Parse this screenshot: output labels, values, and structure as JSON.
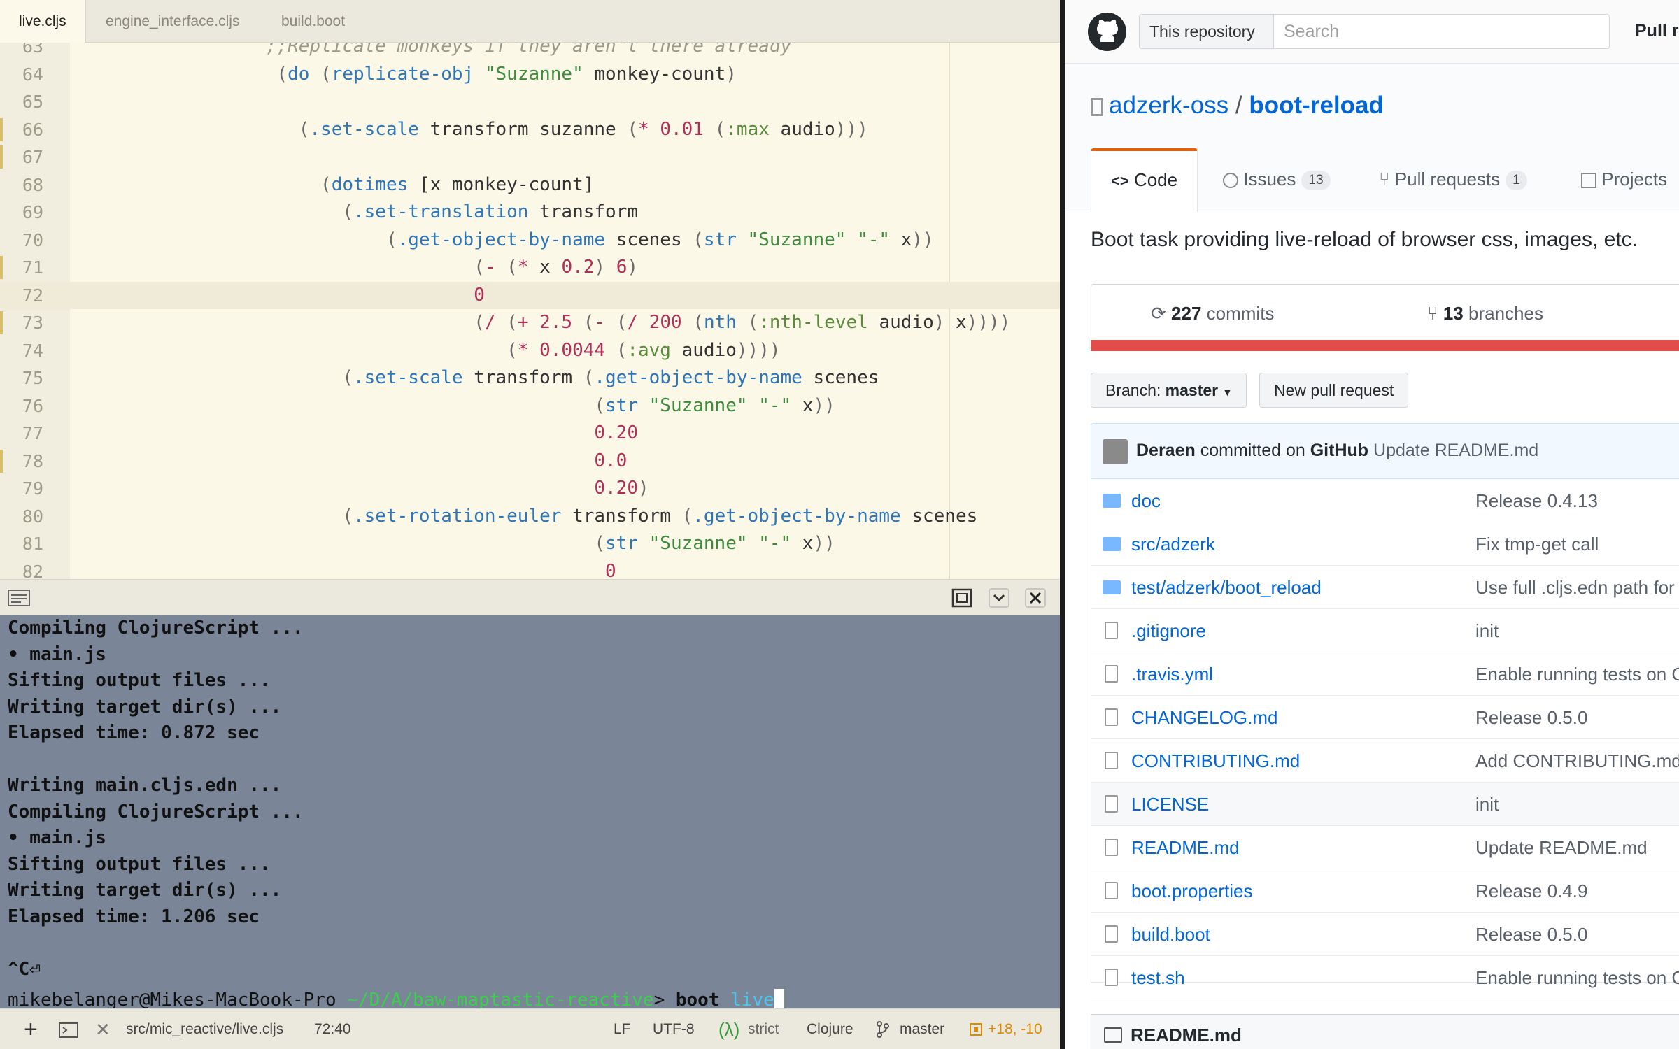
{
  "editor": {
    "tabs": [
      {
        "label": "live.cljs"
      },
      {
        "label": "engine_interface.cljs"
      },
      {
        "label": "build.boot"
      }
    ],
    "lines": [
      {
        "n": "63",
        "html": "<span class=\"cmt\">                  ;;Replicate monkeys if they aren't there already</span>",
        "mark": false
      },
      {
        "n": "64",
        "html": "                   <span class=\"br\">(</span><span class=\"fn\">do</span> <span class=\"br\">(</span><span class=\"fn\">replicate-obj</span> <span class=\"str\">\"Suzanne\"</span> monkey-count<span class=\"br\">)</span>",
        "mark": false
      },
      {
        "n": "65",
        "html": "",
        "mark": false
      },
      {
        "n": "66",
        "html": "                     <span class=\"br\">(</span><span class=\"fn\">.set-scale</span> transform suzanne <span class=\"br\">(</span><span class=\"op\">*</span> <span class=\"num\">0.01</span> <span class=\"br\">(</span><span class=\"kw\">:max</span> audio<span class=\"br\">)))</span>",
        "mark": true
      },
      {
        "n": "67",
        "html": "",
        "mark": true
      },
      {
        "n": "68",
        "html": "                       <span class=\"br\">(</span><span class=\"fn\">dotimes</span> [x monkey-count]",
        "mark": false
      },
      {
        "n": "69",
        "html": "                         <span class=\"br\">(</span><span class=\"fn\">.set-translation</span> transform",
        "mark": false
      },
      {
        "n": "70",
        "html": "                             <span class=\"br\">(</span><span class=\"fn\">.get-object-by-name</span> scenes <span class=\"br\">(</span><span class=\"fn\">str</span> <span class=\"str\">\"Suzanne\"</span> <span class=\"str\">\"-\"</span> x<span class=\"br\">))</span>",
        "mark": false
      },
      {
        "n": "71",
        "html": "                                     <span class=\"br\">(</span><span class=\"op\">-</span> <span class=\"br\">(</span><span class=\"op\">*</span> x <span class=\"num\">0.2</span><span class=\"br\">)</span> <span class=\"num\">6</span><span class=\"br\">)</span>",
        "mark": true
      },
      {
        "n": "72",
        "html": "                                     <span class=\"num\">0</span>",
        "mark": false,
        "cur": true
      },
      {
        "n": "73",
        "html": "                                     <span class=\"br\">(</span><span class=\"op\">/</span> <span class=\"br\">(</span><span class=\"op\">+</span> <span class=\"num\">2.5</span> <span class=\"br\">(</span><span class=\"op\">-</span> <span class=\"br\">(</span><span class=\"op\">/</span> <span class=\"num\">200</span> <span class=\"br\">(</span><span class=\"fn\">nth</span> <span class=\"br\">(</span><span class=\"kw\">:nth-level</span> audio<span class=\"br\">)</span> x<span class=\"br\">))))</span>",
        "mark": true
      },
      {
        "n": "74",
        "html": "                                        <span class=\"br\">(</span><span class=\"op\">*</span> <span class=\"num\">0.0044</span> <span class=\"br\">(</span><span class=\"kw\">:avg</span> audio<span class=\"br\">))))</span>",
        "mark": false
      },
      {
        "n": "75",
        "html": "                         <span class=\"br\">(</span><span class=\"fn\">.set-scale</span> transform <span class=\"br\">(</span><span class=\"fn\">.get-object-by-name</span> scenes",
        "mark": false
      },
      {
        "n": "76",
        "html": "                                                <span class=\"br\">(</span><span class=\"fn\">str</span> <span class=\"str\">\"Suzanne\"</span> <span class=\"str\">\"-\"</span> x<span class=\"br\">))</span>",
        "mark": false
      },
      {
        "n": "77",
        "html": "                                                <span class=\"num\">0.20</span>",
        "mark": false
      },
      {
        "n": "78",
        "html": "                                                <span class=\"num\">0.0</span>",
        "mark": true
      },
      {
        "n": "79",
        "html": "                                                <span class=\"num\">0.20</span><span class=\"br\">)</span>",
        "mark": false
      },
      {
        "n": "80",
        "html": "                         <span class=\"br\">(</span><span class=\"fn\">.set-rotation-euler</span> transform <span class=\"br\">(</span><span class=\"fn\">.get-object-by-name</span> scenes",
        "mark": false
      },
      {
        "n": "81",
        "html": "                                                <span class=\"br\">(</span><span class=\"fn\">str</span> <span class=\"str\">\"Suzanne\"</span> <span class=\"str\">\"-\"</span> x<span class=\"br\">))</span>",
        "mark": false
      },
      {
        "n": "82",
        "html": "                                                 <span class=\"num\">0</span>",
        "mark": false
      }
    ]
  },
  "terminal": {
    "lines": [
      "Compiling ClojureScript ...",
      "• main.js",
      "Sifting output files ...",
      "Writing target dir(s) ...",
      "Elapsed time: 0.872 sec",
      "",
      "Writing main.cljs.edn ...",
      "Compiling ClojureScript ...",
      "• main.js",
      "Sifting output files ...",
      "Writing target dir(s) ...",
      "Elapsed time: 1.206 sec",
      "",
      "^C⏎"
    ],
    "prompt": {
      "user": "mikebelanger@Mikes-MacBook-Pro",
      "path": "~/D/A/baw-maptastic-reactive",
      "arrow": ">",
      "cmd": "boot",
      "arg": "live"
    }
  },
  "statusbar": {
    "path": "src/mic_reactive/live.cljs",
    "pos": "72:40",
    "eol": "LF",
    "enc": "UTF-8",
    "lambda": "(λ)",
    "strict": "strict",
    "lang": "Clojure",
    "branch": "master",
    "diff": "+18, -10"
  },
  "github": {
    "scope": "This repository",
    "search_placeholder": "Search",
    "pull": "Pull re",
    "owner": "adzerk-oss",
    "sep": "/",
    "repo": "boot-reload",
    "tabs": [
      {
        "label": "Code",
        "icon": "<>"
      },
      {
        "label": "Issues",
        "count": "13"
      },
      {
        "label": "Pull requests",
        "count": "1"
      },
      {
        "label": "Projects"
      }
    ],
    "description": "Boot task providing live-reload of browser css, images, etc.",
    "commits_num": "227",
    "commits_label": "commits",
    "branches_num": "13",
    "branches_label": "branches",
    "branch_prefix": "Branch:",
    "branch": "master",
    "new_pr": "New pull request",
    "commit_author": "Deraen",
    "commit_on": "committed on",
    "commit_via": "GitHub",
    "commit_msg": "Update README.md",
    "files": [
      {
        "name": "doc",
        "msg": "Release 0.4.13",
        "type": "folder"
      },
      {
        "name": "src/adzerk",
        "msg": "Fix tmp-get call",
        "type": "folder"
      },
      {
        "name": "test/adzerk/boot_reload",
        "msg": "Use full .cljs.edn path for",
        "type": "folder"
      },
      {
        "name": ".gitignore",
        "msg": "init",
        "type": "file"
      },
      {
        "name": ".travis.yml",
        "msg": "Enable running tests on C",
        "type": "file"
      },
      {
        "name": "CHANGELOG.md",
        "msg": "Release 0.5.0",
        "type": "file"
      },
      {
        "name": "CONTRIBUTING.md",
        "msg": "Add CONTRIBUTING.md",
        "type": "file"
      },
      {
        "name": "LICENSE",
        "msg": "init",
        "type": "file",
        "hl": true
      },
      {
        "name": "README.md",
        "msg": "Update README.md",
        "type": "file"
      },
      {
        "name": "boot.properties",
        "msg": "Release 0.4.9",
        "type": "file"
      },
      {
        "name": "build.boot",
        "msg": "Release 0.5.0",
        "type": "file"
      },
      {
        "name": "test.sh",
        "msg": "Enable running tests on C",
        "type": "file"
      }
    ],
    "readme": "README.md"
  },
  "colors": {
    "accent": "#0366d6",
    "tab_underline": "#e36209",
    "lang_bar": "#e44b4b",
    "terminal_bg": "#7a8598"
  }
}
